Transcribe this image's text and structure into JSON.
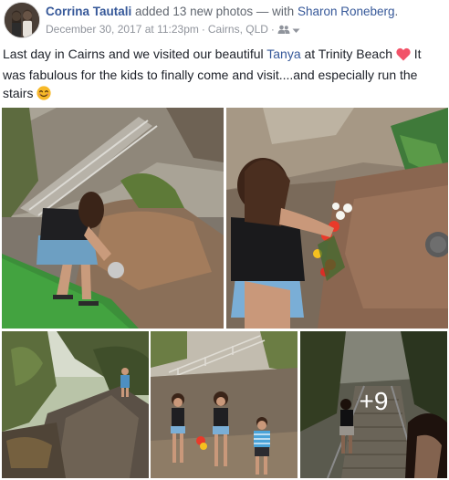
{
  "post": {
    "author": "Corrina Tautali",
    "action": "added 13 new photos",
    "with_prefix": "— with",
    "tagged_person": "Sharon Roneberg",
    "tagged_suffix": ".",
    "timestamp": "December 30, 2017 at 11:23pm",
    "location": "Cairns, QLD",
    "privacy_icon": "friends-icon",
    "text_part1": "Last day in Cairns and we visited our beautiful ",
    "text_tag": "Tanya",
    "text_part2": " at Trinity Beach ",
    "text_part3": " It was fabulous for the kids to finally come and visit....and especially run the stairs ",
    "emoji_heart": "heart-emoji",
    "emoji_smile": "smile-emoji"
  },
  "gallery": {
    "photo_count_total": 13,
    "more_label": "+9"
  },
  "colors": {
    "link": "#365899",
    "secondary_text": "#90949c",
    "heart": "#f25268",
    "smile": "#f7b928"
  }
}
